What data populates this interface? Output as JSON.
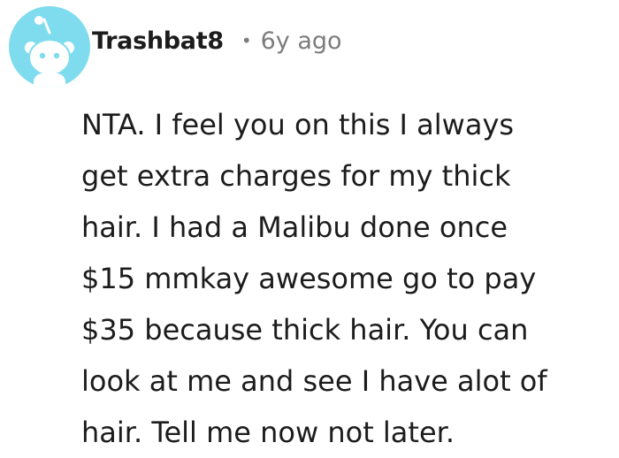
{
  "comment": {
    "username": "Trashbat8",
    "separator": "•",
    "timestamp": "6y ago",
    "avatar_icon": "snoo-avatar-icon",
    "avatar_color": "#7fdcef",
    "body_lines": [
      "NTA. I feel you on this I always",
      "get extra charges for my thick",
      "hair. I had a Malibu done once",
      "$15 mmkay awesome go to pay",
      "$35 because thick hair. You can",
      "look at me and see I have alot of",
      "hair. Tell me now not later."
    ]
  }
}
